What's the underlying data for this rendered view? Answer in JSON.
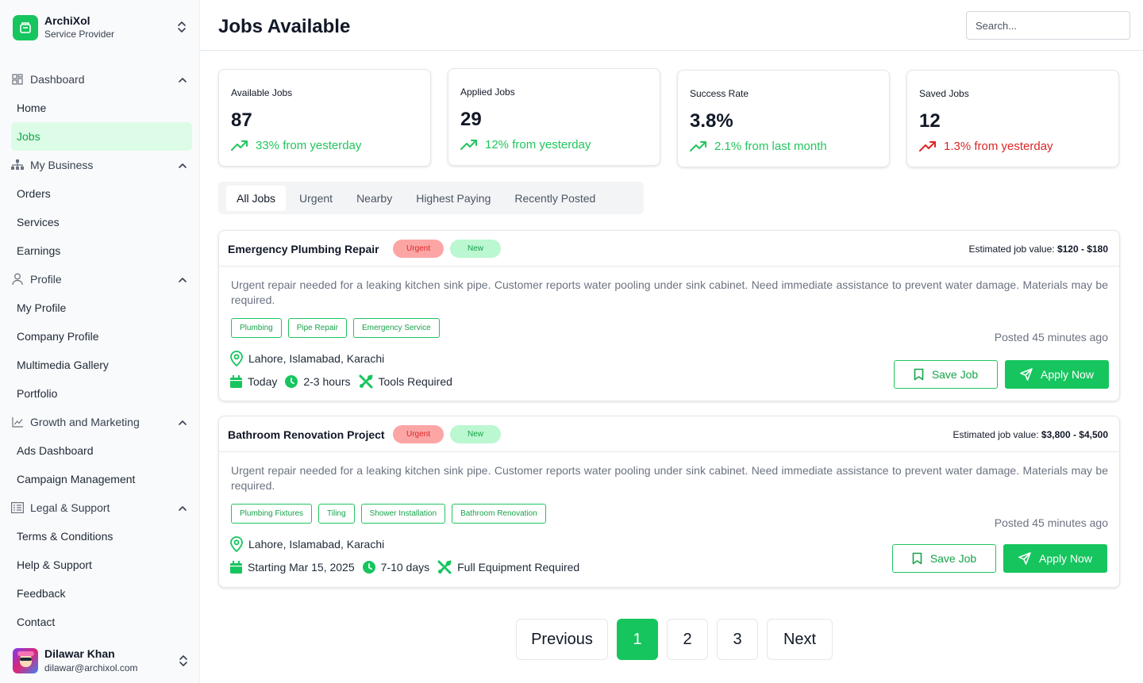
{
  "brand": {
    "name": "ArchiXol",
    "subtitle": "Service Provider"
  },
  "nav": [
    {
      "group": "Dashboard",
      "icon": "dashboard-icon",
      "items": [
        "Home",
        "Jobs"
      ]
    },
    {
      "group": "My Business",
      "icon": "network-icon",
      "items": [
        "Orders",
        "Services",
        "Earnings"
      ]
    },
    {
      "group": "Profile",
      "icon": "user-icon",
      "items": [
        "My Profile",
        "Company Profile",
        "Multimedia Gallery",
        "Portfolio"
      ]
    },
    {
      "group": "Growth and Marketing",
      "icon": "chart-icon",
      "items": [
        "Ads Dashboard",
        "Campaign Management"
      ]
    },
    {
      "group": "Legal & Support",
      "icon": "list-icon",
      "items": [
        "Terms & Conditions",
        "Help & Support",
        "Feedback",
        "Contact"
      ]
    }
  ],
  "active_item": "Jobs",
  "user": {
    "name": "Dilawar Khan",
    "email": "dilawar@archixol.com"
  },
  "header": {
    "title": "Jobs Available",
    "search_placeholder": "Search..."
  },
  "stats": [
    {
      "label": "Available Jobs",
      "value": "87",
      "change": "33% from yesterday",
      "trend": "up",
      "color": "#22c55e"
    },
    {
      "label": "Applied Jobs",
      "value": "29",
      "change": "12% from yesterday",
      "trend": "up",
      "color": "#22c55e"
    },
    {
      "label": "Success Rate",
      "value": "3.8%",
      "change": "2.1% from last month",
      "trend": "up",
      "color": "#22c55e"
    },
    {
      "label": "Saved Jobs",
      "value": "12",
      "change": "1.3% from yesterday",
      "trend": "up",
      "color": "#dc2626"
    }
  ],
  "filters": {
    "tabs": [
      "All Jobs",
      "Urgent",
      "Nearby",
      "Highest Paying",
      "Recently Posted"
    ],
    "active": "All Jobs"
  },
  "jobs": [
    {
      "title": "Emergency Plumbing Repair",
      "badges": [
        "Urgent",
        "New"
      ],
      "est_label": "Estimated job value:",
      "est_value": "$120 - $180",
      "description": "Urgent repair needed for a leaking kitchen sink pipe. Customer reports water pooling under sink cabinet. Need immediate assistance to prevent water damage. Materials may be required.",
      "tags": [
        "Plumbing",
        "Pipe Repair",
        "Emergency Service"
      ],
      "posted": "Posted 45 minutes ago",
      "location": "Lahore, Islamabad, Karachi",
      "date": "Today",
      "duration": "2-3 hours",
      "equipment": "Tools Required",
      "save_label": "Save Job",
      "apply_label": "Apply Now"
    },
    {
      "title": "Bathroom Renovation Project",
      "badges": [
        "Urgent",
        "New"
      ],
      "est_label": "Estimated job value:",
      "est_value": "$3,800 - $4,500",
      "description": "Urgent repair needed for a leaking kitchen sink pipe. Customer reports water pooling under sink cabinet. Need immediate assistance to prevent water damage. Materials may be required.",
      "tags": [
        "Plumbing Fixtures",
        "Tiling",
        "Shower Installation",
        "Bathroom Renovation"
      ],
      "posted": "Posted 45 minutes ago",
      "location": "Lahore, Islamabad, Karachi",
      "date": "Starting Mar 15, 2025",
      "duration": "7-10 days",
      "equipment": "Full Equipment Required",
      "save_label": "Save Job",
      "apply_label": "Apply Now"
    }
  ],
  "pagination": {
    "previous": "Previous",
    "pages": [
      "1",
      "2",
      "3"
    ],
    "current": "1",
    "next": "Next"
  },
  "colors": {
    "accent": "#16c55e",
    "accent_light": "#dcfce7",
    "danger": "#dc2626"
  }
}
